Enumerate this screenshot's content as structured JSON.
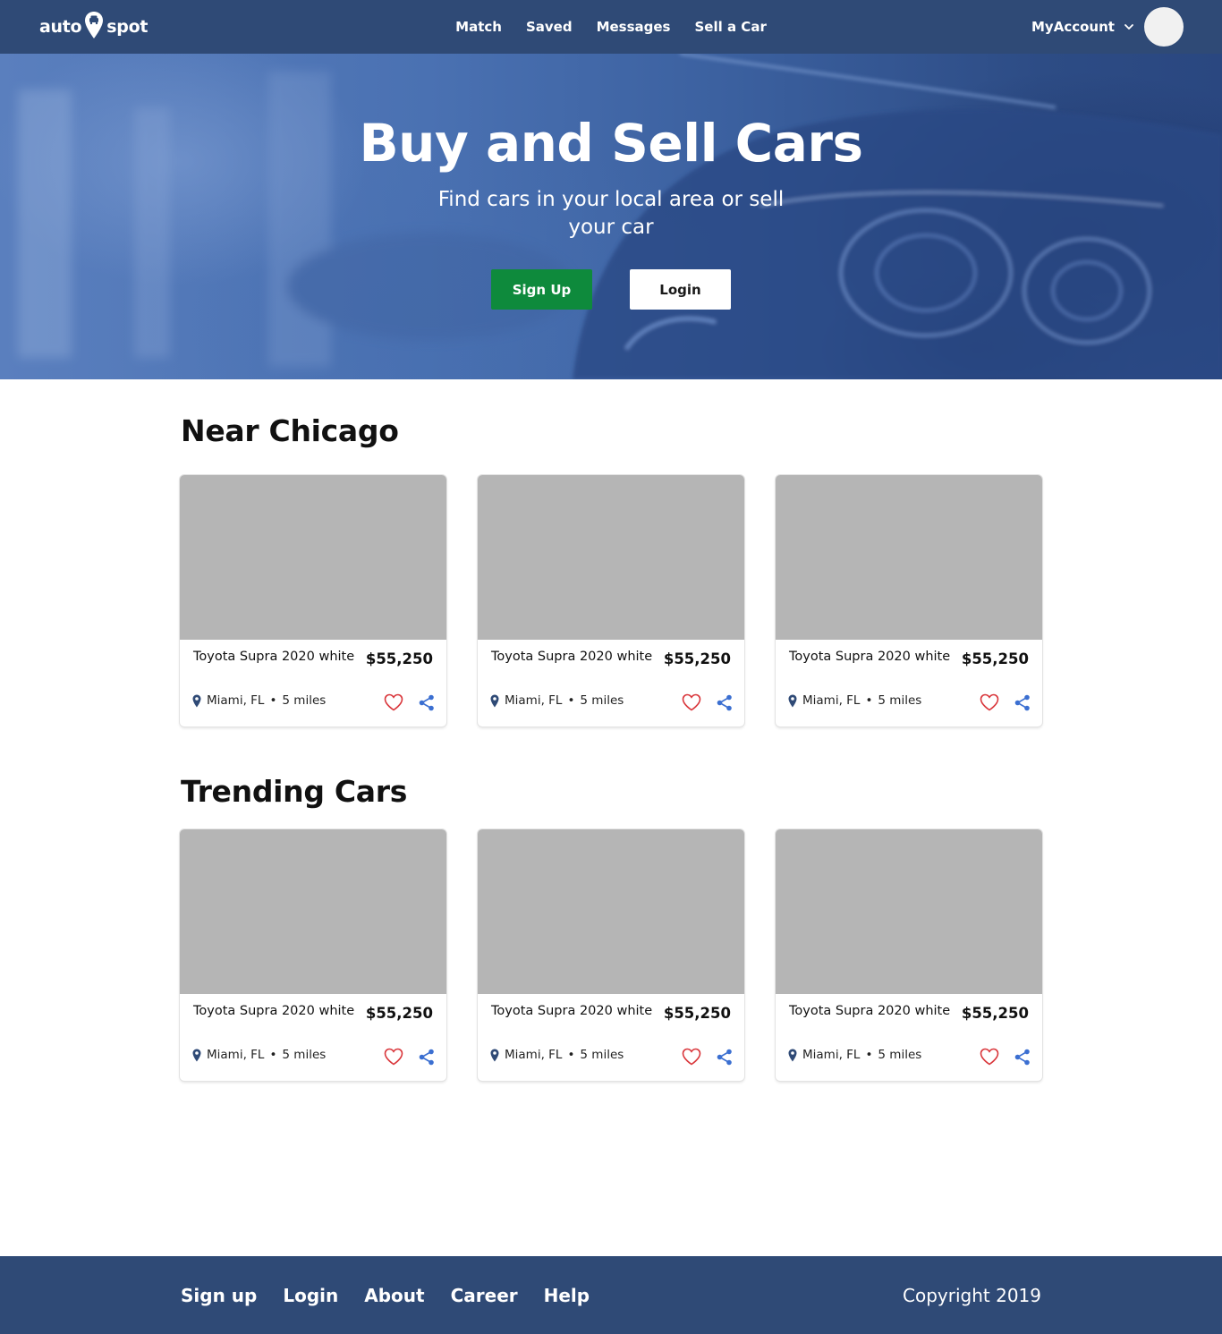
{
  "colors": {
    "brand": "#2f4a76",
    "accent_green": "#0e8a3c",
    "heart": "#d9353a",
    "share": "#3b6fd1",
    "placeholder": "#b5b5b5"
  },
  "header": {
    "logo_left": "auto",
    "logo_right": "spot",
    "logo_icon": "car-location-pin-icon",
    "nav": [
      "Match",
      "Saved",
      "Messages",
      "Sell a Car"
    ],
    "account_label": "MyAccount",
    "account_icon": "chevron-down-icon"
  },
  "hero": {
    "title": "Buy and Sell Cars",
    "subtitle": "Find cars in your local area or sell your car",
    "signup_label": "Sign Up",
    "login_label": "Login"
  },
  "sections": [
    {
      "title": "Near Chicago",
      "cards": [
        {
          "name": "Toyota Supra 2020 white",
          "price": "$55,250",
          "location": "Miami, FL",
          "distance": "5 miles"
        },
        {
          "name": "Toyota Supra 2020 white",
          "price": "$55,250",
          "location": "Miami, FL",
          "distance": "5 miles"
        },
        {
          "name": "Toyota Supra 2020 white",
          "price": "$55,250",
          "location": "Miami, FL",
          "distance": "5 miles"
        }
      ]
    },
    {
      "title": "Trending Cars",
      "cards": [
        {
          "name": "Toyota Supra 2020 white",
          "price": "$55,250",
          "location": "Miami, FL",
          "distance": "5 miles"
        },
        {
          "name": "Toyota Supra 2020 white",
          "price": "$55,250",
          "location": "Miami, FL",
          "distance": "5 miles"
        },
        {
          "name": "Toyota Supra 2020 white",
          "price": "$55,250",
          "location": "Miami, FL",
          "distance": "5 miles"
        }
      ]
    }
  ],
  "card_separator": "•",
  "icons": {
    "location": "map-pin-icon",
    "favorite": "heart-icon",
    "share": "share-icon"
  },
  "footer": {
    "links": [
      "Sign up",
      "Login",
      "About",
      "Career",
      "Help"
    ],
    "copyright": "Copyright 2019"
  }
}
